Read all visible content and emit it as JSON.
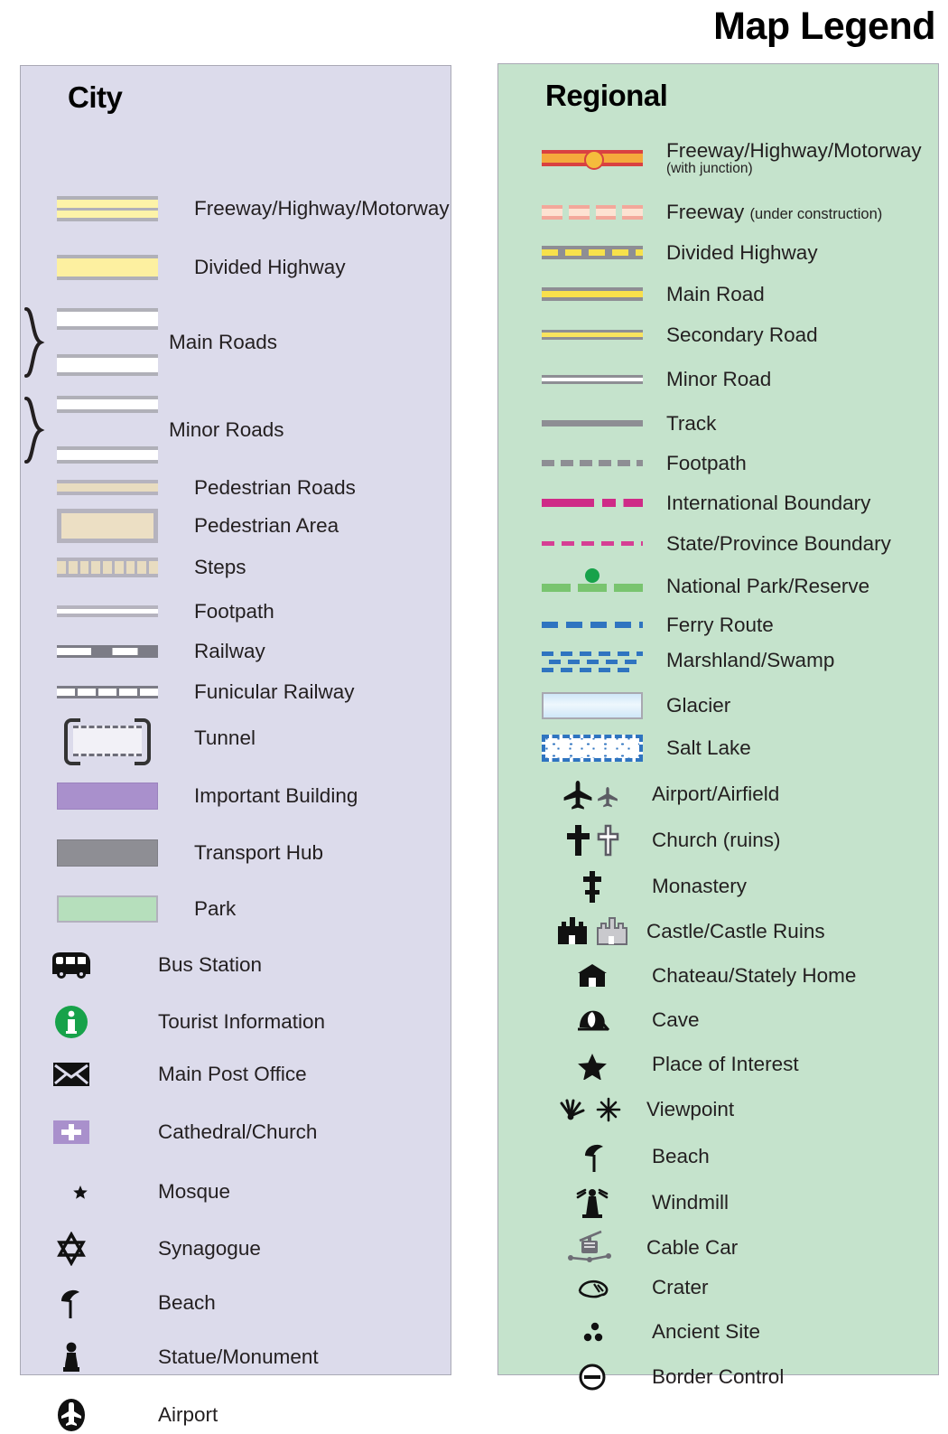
{
  "title": "Map Legend",
  "city": {
    "heading": "City",
    "items": [
      {
        "label": "Freeway/Highway/Motorway",
        "symbol": "freeway-band"
      },
      {
        "label": "Divided Highway",
        "symbol": "divided-highway-band"
      },
      {
        "label": "Main Roads",
        "symbol": "main-roads-pair-brace"
      },
      {
        "label": "Minor Roads",
        "symbol": "minor-roads-pair-brace"
      },
      {
        "label": "Pedestrian Roads",
        "symbol": "pedestrian-road-band"
      },
      {
        "label": "Pedestrian Area",
        "symbol": "pedestrian-area-block"
      },
      {
        "label": "Steps",
        "symbol": "steps-band"
      },
      {
        "label": "Footpath",
        "symbol": "footpath-band"
      },
      {
        "label": "Railway",
        "symbol": "railway-band"
      },
      {
        "label": "Funicular Railway",
        "symbol": "funicular-railway-band"
      },
      {
        "label": "Tunnel",
        "symbol": "tunnel-bracket"
      },
      {
        "label": "Important Building",
        "symbol": "important-building-swatch"
      },
      {
        "label": "Transport Hub",
        "symbol": "transport-hub-swatch"
      },
      {
        "label": "Park",
        "symbol": "park-swatch"
      },
      {
        "label": "Bus Station",
        "symbol": "bus-icon"
      },
      {
        "label": "Tourist Information",
        "symbol": "information-icon"
      },
      {
        "label": "Main Post Office",
        "symbol": "envelope-icon"
      },
      {
        "label": "Cathedral/Church",
        "symbol": "church-cross-icon"
      },
      {
        "label": "Mosque",
        "symbol": "crescent-star-icon"
      },
      {
        "label": "Synagogue",
        "symbol": "star-of-david-icon"
      },
      {
        "label": "Beach",
        "symbol": "beach-umbrella-icon"
      },
      {
        "label": "Statue/Monument",
        "symbol": "statue-icon"
      },
      {
        "label": "Airport",
        "symbol": "airport-plane-icon"
      }
    ]
  },
  "regional": {
    "heading": "Regional",
    "items": [
      {
        "label": "Freeway/Highway/Motorway",
        "sublabel": "(with junction)",
        "symbol": "freeway-junction-line"
      },
      {
        "label": "Freeway",
        "inline_note": "(under construction)",
        "symbol": "freeway-construction-line"
      },
      {
        "label": "Divided Highway",
        "symbol": "divided-highway-line"
      },
      {
        "label": "Main Road",
        "symbol": "main-road-line"
      },
      {
        "label": "Secondary Road",
        "symbol": "secondary-road-line"
      },
      {
        "label": "Minor Road",
        "symbol": "minor-road-line"
      },
      {
        "label": "Track",
        "symbol": "track-line"
      },
      {
        "label": "Footpath",
        "symbol": "footpath-dashed-line"
      },
      {
        "label": "International Boundary",
        "symbol": "international-boundary-line"
      },
      {
        "label": "State/Province Boundary",
        "symbol": "state-boundary-line"
      },
      {
        "label": "National Park/Reserve",
        "symbol": "national-park-line"
      },
      {
        "label": "Ferry Route",
        "symbol": "ferry-route-line"
      },
      {
        "label": "Marshland/Swamp",
        "symbol": "marshland-pattern"
      },
      {
        "label": "Glacier",
        "symbol": "glacier-swatch"
      },
      {
        "label": "Salt Lake",
        "symbol": "salt-lake-swatch"
      },
      {
        "label": "Airport/Airfield",
        "symbol": "airport-airfield-icon"
      },
      {
        "label": "Church (ruins)",
        "symbol": "church-ruins-icon"
      },
      {
        "label": "Monastery",
        "symbol": "monastery-cross-icon"
      },
      {
        "label": "Castle/Castle Ruins",
        "symbol": "castle-icon"
      },
      {
        "label": "Chateau/Stately Home",
        "symbol": "chateau-icon"
      },
      {
        "label": "Cave",
        "symbol": "cave-icon"
      },
      {
        "label": "Place of Interest",
        "symbol": "star-icon"
      },
      {
        "label": "Viewpoint",
        "symbol": "viewpoint-icon"
      },
      {
        "label": "Beach",
        "symbol": "beach-umbrella-icon"
      },
      {
        "label": "Windmill",
        "symbol": "windmill-icon"
      },
      {
        "label": "Cable Car",
        "symbol": "cable-car-icon"
      },
      {
        "label": "Crater",
        "symbol": "crater-icon"
      },
      {
        "label": "Ancient Site",
        "symbol": "ancient-site-icon"
      },
      {
        "label": "Border Control",
        "symbol": "border-control-icon"
      }
    ]
  },
  "colors": {
    "city_panel_bg": "#dcdbeb",
    "regional_panel_bg": "#c5e3cc",
    "highway_yellow": "#fdf0a0",
    "freeway_red": "#d94141",
    "freeway_orange": "#f5a93c",
    "boundary_magenta": "#cf2b87",
    "park_green": "#79c46f",
    "water_blue": "#2f74c0",
    "important_building_purple": "#a990cc",
    "transport_hub_gray": "#8e8e94",
    "park_swatch_green": "#b6dfbc",
    "pedestrian_tan": "#e8dcc0",
    "info_green": "#17a24a"
  }
}
